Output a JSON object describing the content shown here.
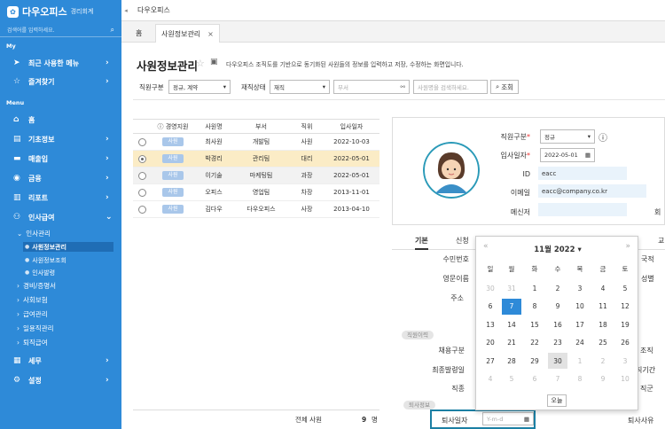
{
  "app": {
    "brand": "다우오피스",
    "sub": "경리회계",
    "search_placeholder": "검색어를 입력하세요."
  },
  "sidebar": {
    "section_my": "My",
    "recent": "최근 사용한 메뉴",
    "favorites": "즐겨찾기",
    "section_menu": "Menu",
    "home": "홈",
    "basic": "기초정보",
    "sales": "매출입",
    "finance": "금융",
    "report": "리포트",
    "hr": "인사급여",
    "hr_manage": "인사관리",
    "hr_items": [
      "사원정보관리",
      "사원정보조회",
      "인사발령"
    ],
    "expense": "경비/증명서",
    "insurance": "사회보험",
    "payroll": "급여관리",
    "daily": "일용직관리",
    "retire": "퇴직급여",
    "tax": "세무",
    "settings": "설정"
  },
  "topbar": {
    "title": "다우오피스"
  },
  "tabs": {
    "home": "홈",
    "active": "사원정보관리"
  },
  "page": {
    "title": "사원정보관리",
    "desc": "다우오피스 조직도를 기반으로 동기화된 사원들의 정보를 입력하고 저장, 수정하는 화면입니다."
  },
  "filters": {
    "type_label": "직원구분",
    "type_value": "정규, 계약",
    "status_label": "재직상태",
    "status_value": "재직",
    "dept_placeholder": "부서",
    "name_placeholder": "사원명을 검색하세요.",
    "search_btn": "조회"
  },
  "grid": {
    "headers": [
      "",
      "경영지원",
      "사원명",
      "부서",
      "직위",
      "입사일자"
    ],
    "rows": [
      {
        "badge": "사원",
        "name": "최사원",
        "dept": "개발팀",
        "pos": "사원",
        "date": "2022-10-03"
      },
      {
        "badge": "사원",
        "name": "박경리",
        "dept": "관리팀",
        "pos": "대리",
        "date": "2022-05-01"
      },
      {
        "badge": "사원",
        "name": "이기술",
        "dept": "마케팅팀",
        "pos": "과장",
        "date": "2022-05-01"
      },
      {
        "badge": "사원",
        "name": "오피스",
        "dept": "영업팀",
        "pos": "차장",
        "date": "2013-11-01"
      },
      {
        "badge": "사원",
        "name": "김다우",
        "dept": "다우오피스",
        "pos": "사장",
        "date": "2013-04-10"
      }
    ],
    "total_label": "전체 사원",
    "total_count": "9",
    "total_unit": "명"
  },
  "profile": {
    "type_label": "직원구분",
    "type_value": "정규",
    "hire_label": "입사일자",
    "hire_value": "2022-05-01",
    "id_label": "ID",
    "id_value": "eacc",
    "email_label": "이메일",
    "email_value": "eacc@company.co.kr",
    "messenger_label": "메신저",
    "extra_label": "회"
  },
  "detail_tabs": [
    "기본",
    "신청",
    "교"
  ],
  "detail": {
    "resident": "수민번호",
    "eng_name": "영문이름",
    "address": "주소",
    "nationality": "국적",
    "gender": "성별",
    "job_history": "직원이력",
    "hire_type": "채용구분",
    "last_appoint": "최종발령일",
    "rank": "직종",
    "org": "조직",
    "period": "직기간",
    "grade": "직군",
    "retire_info": "퇴사정보",
    "retire_date": "퇴사일자",
    "retire_date_placeholder": "Y-m-d",
    "retire_reason": "퇴사사유"
  },
  "calendar": {
    "title": "11월 2022 ▾",
    "weekdays": [
      "일",
      "월",
      "화",
      "수",
      "목",
      "금",
      "토"
    ],
    "days": [
      [
        "30",
        "31",
        "1",
        "2",
        "3",
        "4",
        "5"
      ],
      [
        "6",
        "7",
        "8",
        "9",
        "10",
        "11",
        "12"
      ],
      [
        "13",
        "14",
        "15",
        "16",
        "17",
        "18",
        "19"
      ],
      [
        "20",
        "21",
        "22",
        "23",
        "24",
        "25",
        "26"
      ],
      [
        "27",
        "28",
        "29",
        "30",
        "1",
        "2",
        "3"
      ],
      [
        "4",
        "5",
        "6",
        "7",
        "8",
        "9",
        "10"
      ]
    ],
    "today_btn": "오늘"
  },
  "colors": {
    "sidebar": "#2e8ad8",
    "accent": "#1b7fa3",
    "selected_row": "#fbecc6"
  }
}
